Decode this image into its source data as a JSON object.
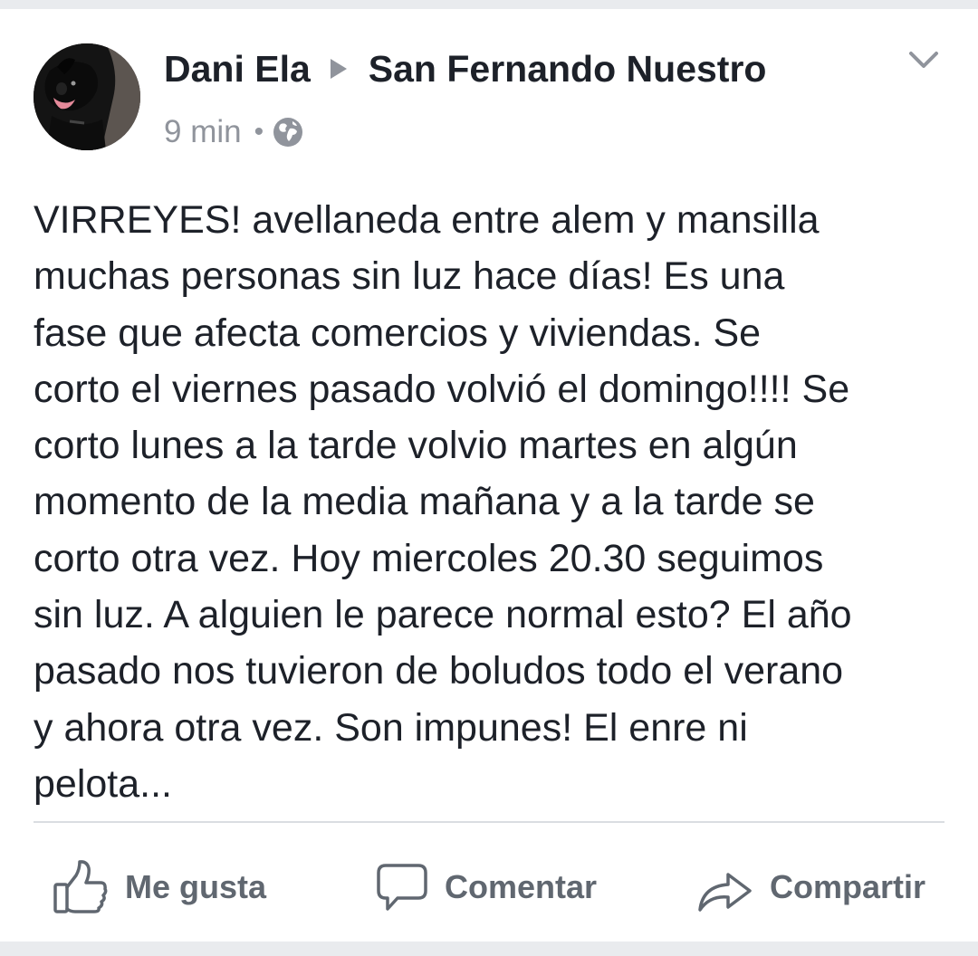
{
  "post": {
    "author": "Dani Ela",
    "group": "San Fernando Nuestro",
    "time": "9 min",
    "meta_separator": "•",
    "privacy_icon": "globe-icon",
    "menu_icon": "chevron-down-icon",
    "text": "VIRREYES! avellaneda entre alem y mansilla\nmuchas personas sin luz hace días! Es una\nfase que afecta comercios y viviendas. Se\ncorto el viernes pasado volvió el domingo!!!! Se\ncorto lunes a la tarde volvio martes en algún\nmomento de la media mañana y a la tarde se\ncorto otra vez. Hoy miercoles 20.30 seguimos\nsin luz. A alguien le parece normal esto? El año\npasado nos tuvieron de boludos todo el verano\ny ahora otra vez. Son impunes! El enre ni\npelota..."
  },
  "actions": {
    "like": {
      "label": "Me gusta",
      "icon": "thumbs-up-icon"
    },
    "comment": {
      "label": "Comentar",
      "icon": "comment-icon"
    },
    "share": {
      "label": "Compartir",
      "icon": "share-icon"
    }
  },
  "colors": {
    "text_primary": "#1d2129",
    "text_secondary": "#90949c",
    "action_text": "#606770",
    "background": "#e9ebee",
    "card": "#ffffff",
    "divider": "#dadde1"
  }
}
